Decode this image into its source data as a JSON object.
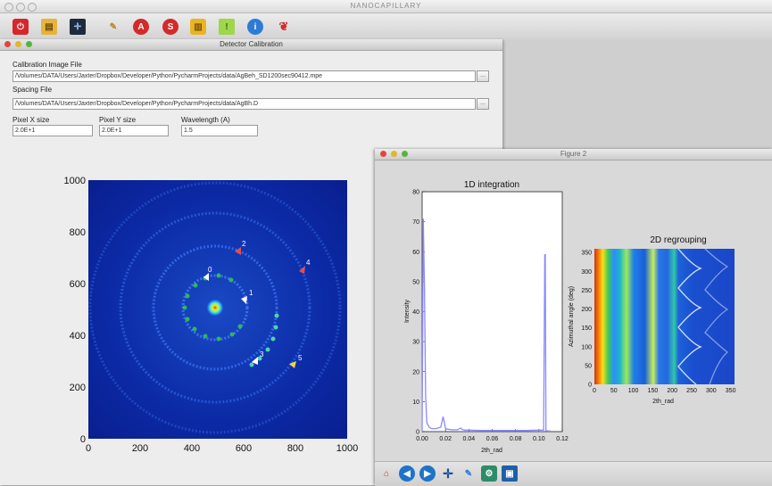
{
  "app": {
    "title": "NANOCAPILLARY"
  },
  "toolbar": {
    "icons": [
      "power-icon",
      "folder-icon",
      "grid-icon",
      "wizard-icon",
      "stop-a-icon",
      "stop-s-icon",
      "jar-icon",
      "flag-icon",
      "info-icon",
      "lamp-icon"
    ]
  },
  "calibration": {
    "title": "Detector Calibration",
    "image_file_label": "Calibration Image File",
    "image_file_value": "/Volumes/DATA/Users/Jaxter/Dropbox/Developer/Python/PycharmProjects/data/AgBeh_SD1200sec90412.mpe",
    "spacing_file_label": "Spacing File",
    "spacing_file_value": "/Volumes/DATA/Users/Jaxter/Dropbox/Developer/Python/PycharmProjects/data/AgBh.D",
    "browse_label": "...",
    "pixel_x_label": "Pixel X size",
    "pixel_x_value": "2.0E+1",
    "pixel_y_label": "Pixel Y size",
    "pixel_y_value": "2.0E+1",
    "wavelength_label": "Wavelength (A)",
    "wavelength_value": "1.5"
  },
  "detector_image": {
    "x_ticks": [
      "0",
      "200",
      "400",
      "600",
      "800",
      "1000"
    ],
    "y_ticks": [
      "0",
      "200",
      "400",
      "600",
      "800",
      "1000"
    ],
    "markers": [
      "0",
      "1",
      "2",
      "3",
      "4",
      "5"
    ]
  },
  "figure2": {
    "title": "Figure 2",
    "toolbar_icons": [
      "home-icon",
      "back-icon",
      "forward-icon",
      "pan-icon",
      "zoom-icon",
      "configure-icon",
      "save-icon"
    ]
  },
  "chart_data": [
    {
      "type": "line",
      "title": "1D integration",
      "xlabel": "2th_rad",
      "ylabel": "Intensity",
      "xlim": [
        0.0,
        0.12
      ],
      "ylim": [
        0,
        80
      ],
      "x_ticks": [
        "0.00",
        "0.02",
        "0.04",
        "0.06",
        "0.08",
        "0.10",
        "0.12"
      ],
      "y_ticks": [
        "0",
        "10",
        "20",
        "30",
        "40",
        "50",
        "60",
        "70",
        "80"
      ],
      "series": [
        {
          "x": [
            0.0,
            0.001,
            0.002,
            0.003,
            0.004,
            0.006,
            0.008,
            0.012,
            0.016,
            0.018,
            0.019,
            0.02,
            0.022,
            0.026,
            0.03,
            0.033,
            0.034,
            0.036,
            0.04,
            0.05,
            0.06,
            0.07,
            0.08,
            0.09,
            0.1,
            0.104,
            0.105,
            0.1055,
            0.106,
            0.108,
            0.11
          ],
          "y": [
            0,
            71,
            48,
            12,
            3,
            1.5,
            1,
            1,
            1.5,
            5,
            3,
            1,
            0.8,
            0.6,
            0.6,
            1.2,
            0.8,
            0.5,
            0.5,
            0.4,
            0.4,
            0.4,
            0.4,
            0.4,
            0.5,
            0.5,
            59,
            59,
            0.3,
            0.2,
            0.2
          ]
        }
      ]
    },
    {
      "type": "heatmap",
      "title": "2D regrouping",
      "xlabel": "2th_rad",
      "ylabel": "Azimuthal angle (deg)",
      "xlim": [
        0,
        360
      ],
      "ylim": [
        0,
        360
      ],
      "x_ticks": [
        "0",
        "50",
        "100",
        "150",
        "200",
        "250",
        "300",
        "350"
      ],
      "y_ticks": [
        "0",
        "50",
        "100",
        "150",
        "200",
        "250",
        "300",
        "350"
      ]
    }
  ]
}
